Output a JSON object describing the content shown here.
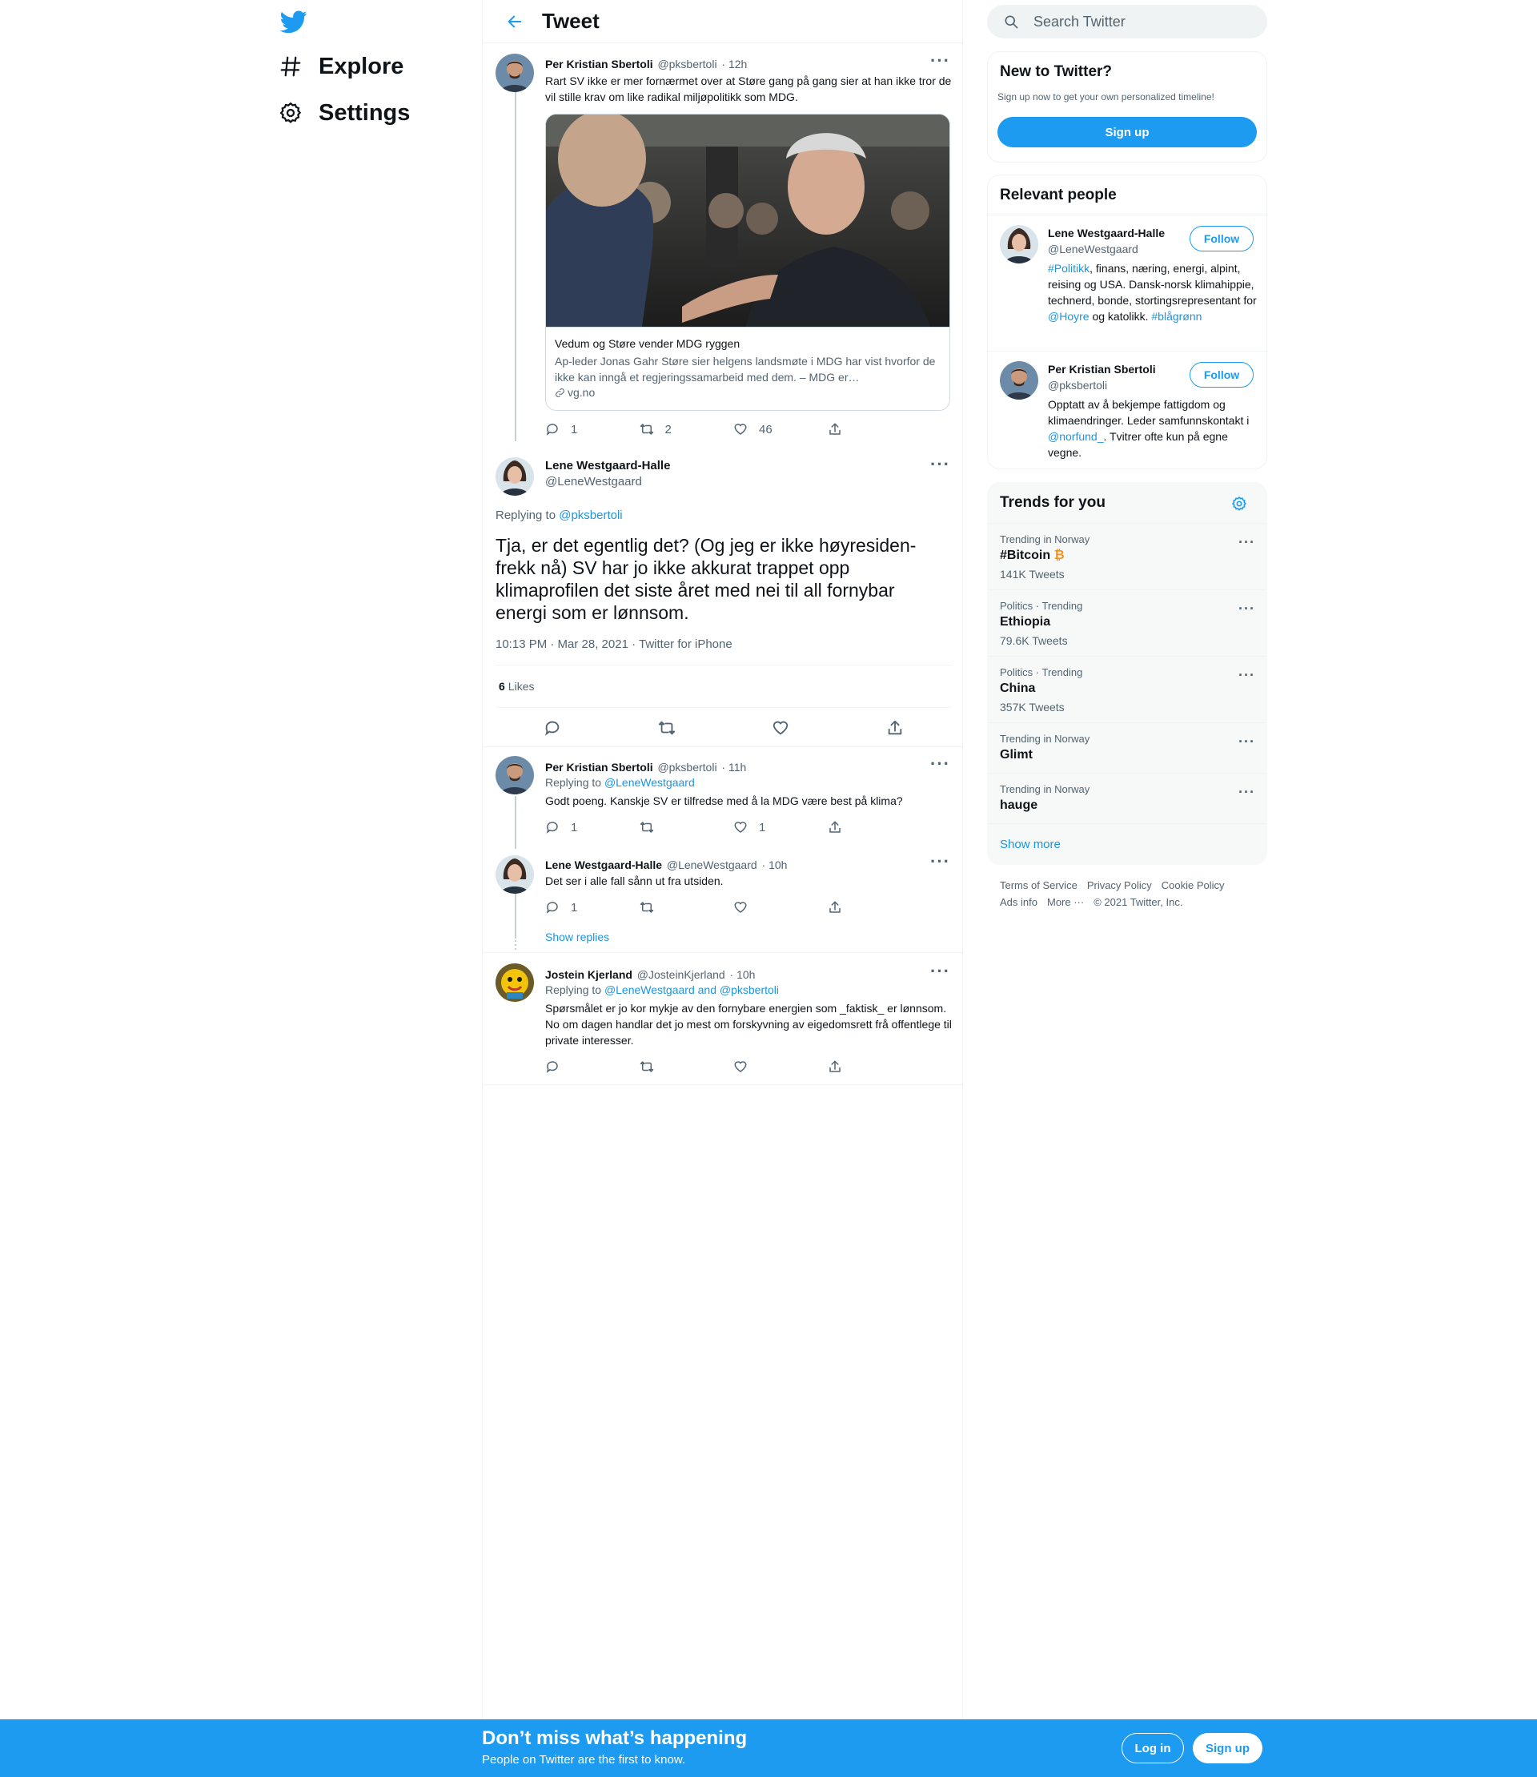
{
  "nav": {
    "explore": "Explore",
    "settings": "Settings"
  },
  "header": {
    "title": "Tweet"
  },
  "parent_tweet": {
    "name": "Per Kristian Sbertoli",
    "handle": "@pksbertoli",
    "time": "· 12h",
    "text": "Rart SV ikke er mer fornærmet over at Støre gang på gang sier at han ikke tror de vil stille krav om like radikal miljøpolitikk som MDG.",
    "card": {
      "title": "Vedum og Støre vender MDG ryggen",
      "description": "Ap-leder Jonas Gahr Støre sier helgens landsmøte i MDG har vist hvorfor de ikke kan inngå et regjeringssamarbeid med dem. – MDG er…",
      "domain": "vg.no"
    },
    "replies": "1",
    "retweets": "2",
    "likes": "46"
  },
  "main_tweet": {
    "name": "Lene Westgaard-Halle",
    "handle": "@LeneWestgaard",
    "replying_prefix": "Replying to",
    "replying_to": "@pksbertoli",
    "text": "Tja, er det egentlig det? (Og jeg er ikke høyresiden-frekk nå) SV har jo ikke akkurat trappet opp klimaprofilen det siste året med nei til all fornybar energi som er lønnsom.",
    "timestamp": "10:13 PM · Mar 28, 2021 · Twitter for iPhone",
    "likes_count": "6",
    "likes_label": "Likes"
  },
  "replies": [
    {
      "name": "Per Kristian Sbertoli",
      "handle": "@pksbertoli",
      "time": "· 11h",
      "replying_prefix": "Replying to",
      "replying_to": "@LeneWestgaard",
      "text": "Godt poeng. Kanskje SV er tilfredse med å la MDG være best på klima?",
      "replies": "1",
      "retweets": "",
      "likes": "1"
    },
    {
      "name": "Lene Westgaard-Halle",
      "handle": "@LeneWestgaard",
      "time": "· 10h",
      "text": "Det ser i alle fall sånn ut fra utsiden.",
      "replies": "1",
      "retweets": "",
      "likes": ""
    },
    {
      "name": "Jostein Kjerland",
      "handle": "@JosteinKjerland",
      "time": "· 10h",
      "replying_prefix": "Replying to",
      "replying_to": "@LeneWestgaard and @pksbertoli",
      "text": "Spørsmålet er jo kor mykje av den fornybare energien som _faktisk_ er lønnsom. No om dagen handlar det jo mest om forskyvning av eigedomsrett frå offentlege til private interesser."
    }
  ],
  "show_replies": "Show replies",
  "search": {
    "placeholder": "Search Twitter"
  },
  "new_to_twitter": {
    "title": "New to Twitter?",
    "subtitle": "Sign up now to get your own personalized timeline!",
    "signup": "Sign up"
  },
  "relevant_people": {
    "title": "Relevant people",
    "follow": "Follow",
    "people": [
      {
        "name": "Lene Westgaard-Halle",
        "handle": "@LeneWestgaard",
        "bio_tag1": "#Politikk",
        "bio_part1": ", finans, næring, energi, alpint, reising og USA. Dansk-norsk klimahippie, technerd, bonde, stortingsrepresentant for ",
        "bio_mention": "@Hoyre",
        "bio_part2": " og katolikk. ",
        "bio_tag2": "#blågrønn"
      },
      {
        "name": "Per Kristian Sbertoli",
        "handle": "@pksbertoli",
        "bio_part1": "Opptatt av å bekjempe fattigdom og klimaendringer. Leder samfunnskontakt i ",
        "bio_mention": "@norfund_",
        "bio_part2": ". Tvitrer ofte kun på egne vegne."
      }
    ]
  },
  "trends": {
    "title": "Trends for you",
    "items": [
      {
        "context": "Trending in Norway",
        "name": "#Bitcoin",
        "emoji": "₿",
        "count": "141K Tweets"
      },
      {
        "context": "Politics · Trending",
        "name": "Ethiopia",
        "count": "79.6K Tweets"
      },
      {
        "context": "Politics · Trending",
        "name": "China",
        "count": "357K Tweets"
      },
      {
        "context": "Trending in Norway",
        "name": "Glimt"
      },
      {
        "context": "Trending in Norway",
        "name": "hauge"
      }
    ],
    "show_more": "Show more"
  },
  "footer": {
    "terms": "Terms of Service",
    "privacy": "Privacy Policy",
    "cookie": "Cookie Policy",
    "ads": "Ads info",
    "more": "More ···",
    "copyright": "© 2021 Twitter, Inc."
  },
  "bottom_bar": {
    "title": "Don’t miss what’s happening",
    "subtitle": "People on Twitter are the first to know.",
    "login": "Log in",
    "signup": "Sign up"
  },
  "colors": {
    "accent": "#1d9bf0",
    "text": "#0f1419",
    "muted": "#536471",
    "border": "#eff3f4",
    "trend_bg": "#f7f9f9"
  }
}
